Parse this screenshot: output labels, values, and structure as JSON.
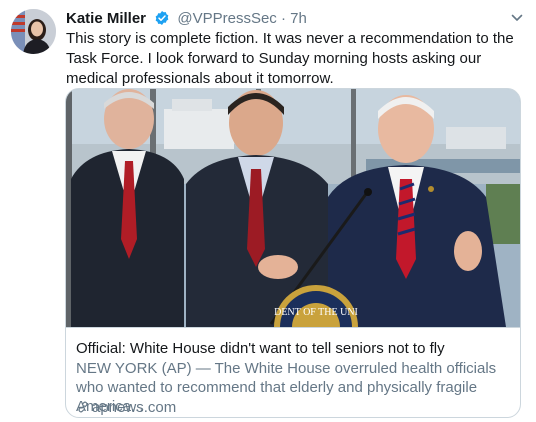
{
  "tweet": {
    "author_name": "Katie Miller",
    "handle": "@VPPressSec",
    "separator": "·",
    "time": "7h",
    "text": "This story is complete fiction. It was never a recommendation to the Task Force. I look forward to Sunday morning hosts asking our medical professionals about it tomorrow."
  },
  "card": {
    "image_seal_text": "DENT OF THE UNI",
    "title": "Official: White House didn't want to tell seniors not to fly",
    "description": "NEW YORK (AP) — The White House overruled health officials who wanted to recommend that elderly and physically fragile America...",
    "domain": "apnews.com"
  },
  "icons": {
    "verified": "verified-badge-icon",
    "more": "chevron-down-icon",
    "link": "link-icon"
  },
  "colors": {
    "text_primary": "#14171a",
    "text_secondary": "#657786",
    "verified_blue": "#1da1f2",
    "border": "#ccd6dd"
  }
}
